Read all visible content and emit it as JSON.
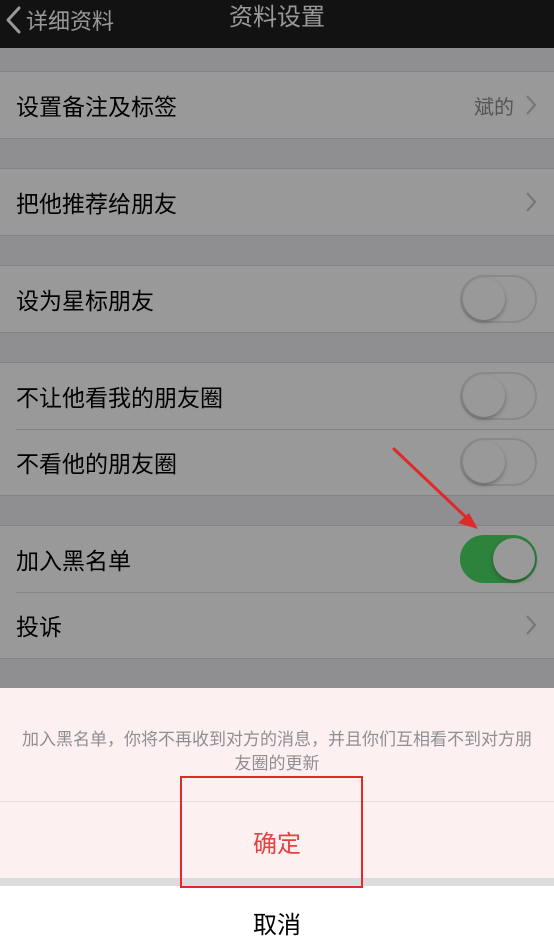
{
  "navbar": {
    "back_label": "详细资料",
    "title": "资料设置"
  },
  "settings": {
    "remark": {
      "label": "设置备注及标签",
      "value": "斌的"
    },
    "recommend": {
      "label": "把他推荐给朋友"
    },
    "star": {
      "label": "设为星标朋友",
      "on": false
    },
    "hide_my_moments": {
      "label": "不让他看我的朋友圈",
      "on": false
    },
    "hide_his_moments": {
      "label": "不看他的朋友圈",
      "on": false
    },
    "blacklist": {
      "label": "加入黑名单",
      "on": true
    },
    "report": {
      "label": "投诉"
    }
  },
  "action_sheet": {
    "message": "加入黑名单，你将不再收到对方的消息，并且你们互相看不到对方朋友圈的更新",
    "confirm_label": "确定",
    "cancel_label": "取消"
  },
  "colors": {
    "toggle_on": "#4cd964",
    "confirm_text": "#e64340",
    "annotation": "#e02a2a"
  }
}
